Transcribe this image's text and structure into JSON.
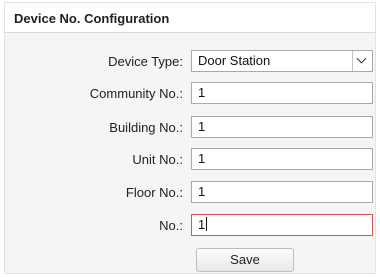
{
  "header": {
    "title": "Device No. Configuration"
  },
  "form": {
    "device_type": {
      "label": "Device Type:",
      "value": "Door Station"
    },
    "community_no": {
      "label": "Community No.:",
      "value": "1"
    },
    "building_no": {
      "label": "Building No.:",
      "value": "1"
    },
    "unit_no": {
      "label": "Unit No.:",
      "value": "1"
    },
    "floor_no": {
      "label": "Floor No.:",
      "value": "1"
    },
    "no": {
      "label": "No.:",
      "value": "1"
    }
  },
  "buttons": {
    "save_label": "Save"
  },
  "icons": {
    "dropdown": "chevron-down-icon"
  },
  "colors": {
    "focus_border": "#d9534f"
  }
}
